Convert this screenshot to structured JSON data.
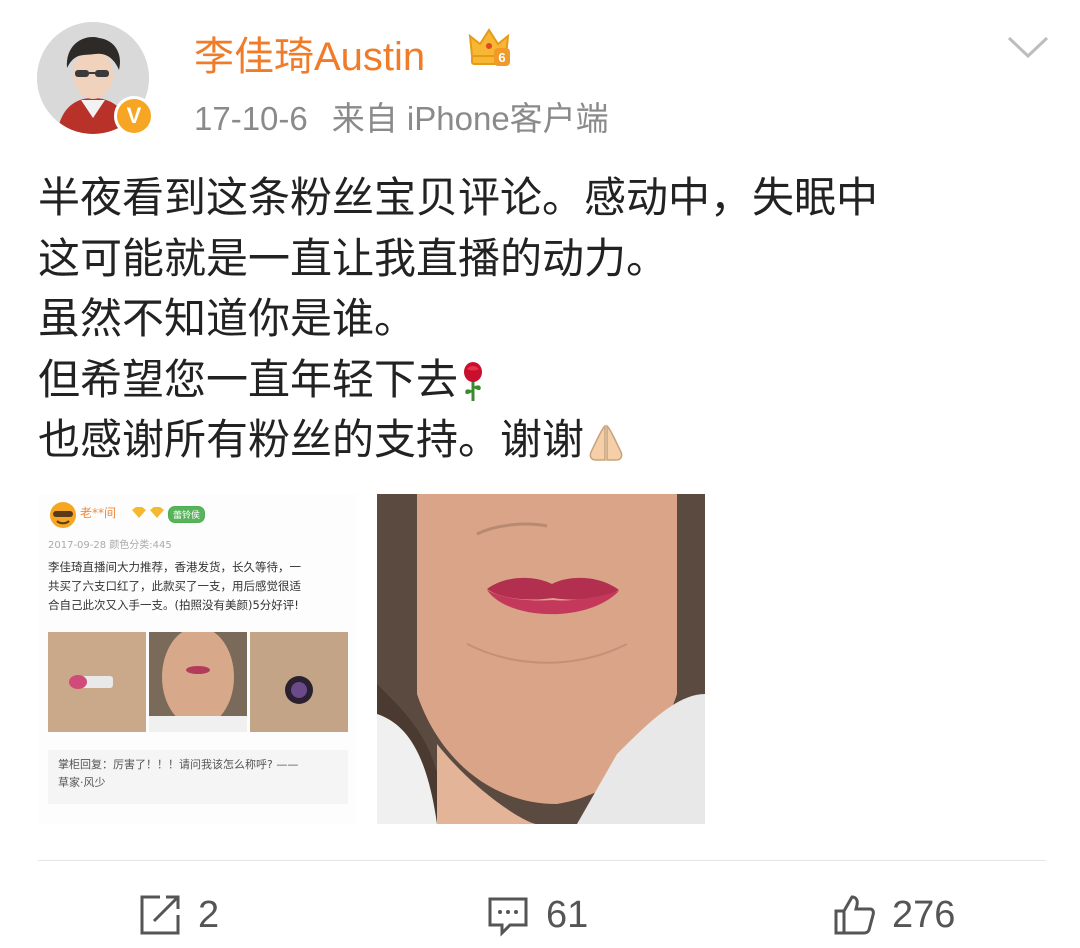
{
  "header": {
    "username": "李佳琦Austin",
    "date": "17-10-6",
    "source": "来自 iPhone客户端",
    "verified_badge": "V",
    "crown_level": "6"
  },
  "post": {
    "lines": [
      "半夜看到这条粉丝宝贝评论。感动中，失眠中",
      "这可能就是一直让我直播的动力。",
      "虽然不知道你是谁。",
      "但希望您一直年轻下去",
      "也感谢所有粉丝的支持。谢谢"
    ],
    "emojis": [
      "rose-icon",
      "praying-hands-icon"
    ]
  },
  "screenshot": {
    "name": "老**间",
    "tag": "蕾铃侯",
    "date": "2017-09-28  颜色分类:445",
    "review_lines": [
      "李佳琦直播间大力推荐，香港发货，长久等待，一",
      "共买了六支口红了，此款买了一支，用后感觉很适",
      "合自己此次又入手一支。(拍照没有美颜)5分好评!"
    ],
    "reply_lines": [
      "掌柜回复：厉害了！！！请问我该怎么称呼? ——",
      "草家·风少"
    ]
  },
  "actions": {
    "repost_count": "2",
    "comment_count": "61",
    "like_count": "276"
  },
  "colors": {
    "username": "#f07c2a",
    "meta": "#8a8a8a",
    "badge": "#f6a623"
  }
}
